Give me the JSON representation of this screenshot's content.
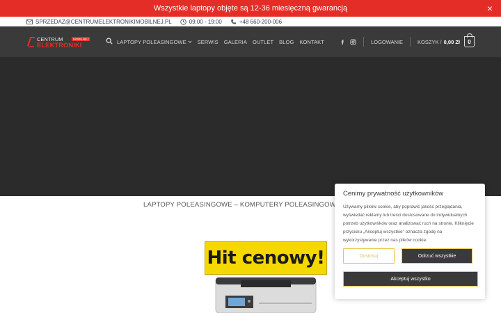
{
  "promo": {
    "text": "Wszystkie laptopy objęte są 12-36 miesięczną gwarancją",
    "close_label": "×"
  },
  "topbar": {
    "email": "SPRZEDAZ@CENTRUMELEKTRONIKIMOBILNEJ.PL",
    "hours": "09:00 - 19:00",
    "phone": "+48 660-200-006"
  },
  "logo": {
    "line1": "CENTRUM",
    "line2": "ELEKTRONIKI",
    "tag": "MOBILNEJ"
  },
  "nav": {
    "items": [
      "LAPTOPY POLEASINGOWE",
      "SERWIS",
      "GALERIA",
      "OUTLET",
      "BLOG",
      "KONTAKT"
    ],
    "login": "LOGOWANIE",
    "cart_label": "KOSZYK /",
    "cart_total": "0,00 Zł",
    "cart_count": "0"
  },
  "breadcrumb": {
    "text": "LAPTOPY POLEASINGOWE – KOMPUTERY  POLEASINGOWE CEM"
  },
  "product": {
    "badge_text": "Hit cenowy!"
  },
  "cookie": {
    "title": "Cenimy prywatność użytkowników",
    "body": "Używamy plików cookie, aby poprawić jakość przeglądania, wyświetlać reklamy lub treści dostosowane do indywidualnych potrzeb użytkowników oraz analizować ruch na stronie. Kliknięcie przycisku „Akceptuj wszystkie” oznacza zgodę na wykorzystywanie przez nas plików cookie.",
    "customize_label": "Dostosuj",
    "reject_label": "Odrzuć wszystkie",
    "accept_label": "Akceptuj wszystko"
  },
  "colors": {
    "promo_bg": "#e52d27",
    "nav_bg": "#3a3a3a",
    "hero_bg": "#2b2b2b",
    "badge_yellow": "#f5d800",
    "cookie_accent": "#e6c64a"
  }
}
